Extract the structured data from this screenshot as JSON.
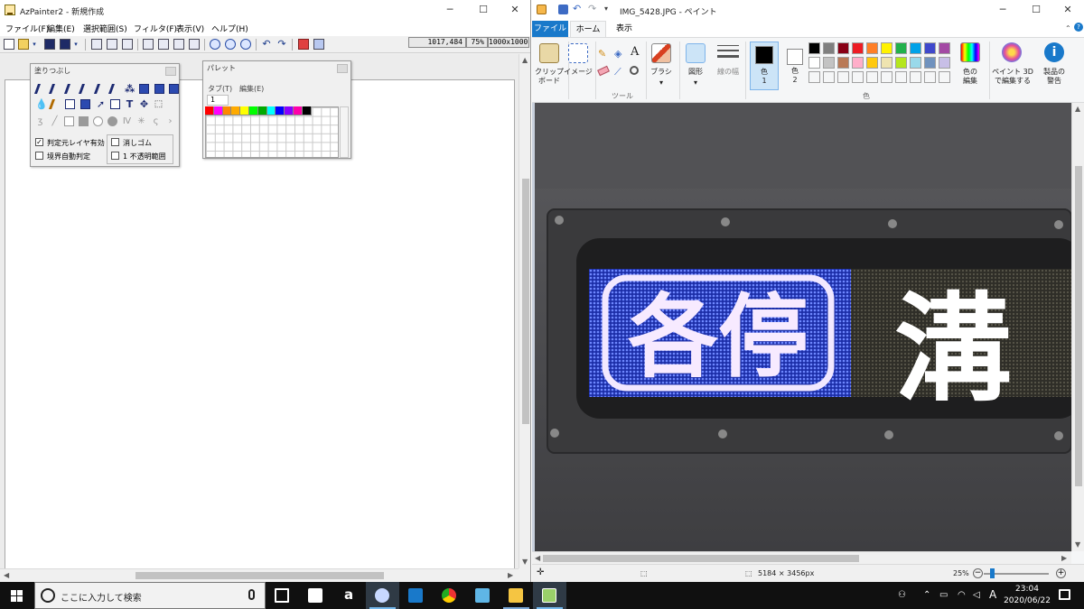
{
  "azpainter": {
    "title": "AzPainter2 - 新規作成",
    "menu": [
      "ファイル(F)",
      "編集(E)",
      "選択範囲(S)",
      "フィルタ(F)",
      "表示(V)",
      "ヘルプ(H)"
    ],
    "status": {
      "coords": "1017,484",
      "zoom": "75%",
      "size": "1000x1000"
    },
    "window_buttons": {
      "minimize": "─",
      "maximize": "☐",
      "close": "✕"
    },
    "fill_panel": {
      "title": "塗りつぶし",
      "options": [
        {
          "label": "判定元レイヤ有効",
          "checked": true
        },
        {
          "label": "境界自動判定",
          "checked": false
        },
        {
          "label": "消しゴム",
          "checked": false
        },
        {
          "label": "1 不透明範囲",
          "checked": false
        }
      ]
    },
    "palette_panel": {
      "title": "パレット",
      "menu": [
        "タブ(T)",
        "編集(E)"
      ],
      "tab": "1",
      "colors": [
        "#ff0000",
        "#ff00ff",
        "#ff8800",
        "#ffaa00",
        "#ffff00",
        "#00ff00",
        "#00aa00",
        "#00ffff",
        "#0000ff",
        "#8800ff",
        "#ff00aa",
        "#000000"
      ]
    }
  },
  "paint": {
    "title": "IMG_5428.JPG - ペイント",
    "tabs": [
      "ファイル",
      "ホーム",
      "表示"
    ],
    "ribbon": {
      "clipboard": "クリップ\nボード",
      "image": "イメージ",
      "tools_group": "ツール",
      "brush": "ブラシ",
      "shapes": "図形",
      "line_width": "線の幅",
      "color1": "色\n1",
      "color2": "色\n2",
      "colors_group": "色",
      "edit_colors": "色の\n編集",
      "paint3d": "ペイント 3D\nで編集する",
      "product_alert": "製品の\n警告"
    },
    "palette_row1": [
      "#000000",
      "#7f7f7f",
      "#880015",
      "#ed1c24",
      "#ff7f27",
      "#fff200",
      "#22b14c",
      "#00a2e8",
      "#3f48cc",
      "#a349a4"
    ],
    "palette_row2": [
      "#ffffff",
      "#c3c3c3",
      "#b97a57",
      "#ffaec9",
      "#ffc90e",
      "#efe4b0",
      "#b5e61d",
      "#99d9ea",
      "#7092be",
      "#c8bfe7"
    ],
    "photo": {
      "sign_left": "各停",
      "sign_right": "溝"
    },
    "status": {
      "dimensions": "5184 × 3456px",
      "zoom": "25%"
    },
    "zoom_level": 0.1
  },
  "taskbar": {
    "search_placeholder": "ここに入力して検索",
    "time": "23:04",
    "date": "2020/06/22",
    "ime": "A"
  }
}
